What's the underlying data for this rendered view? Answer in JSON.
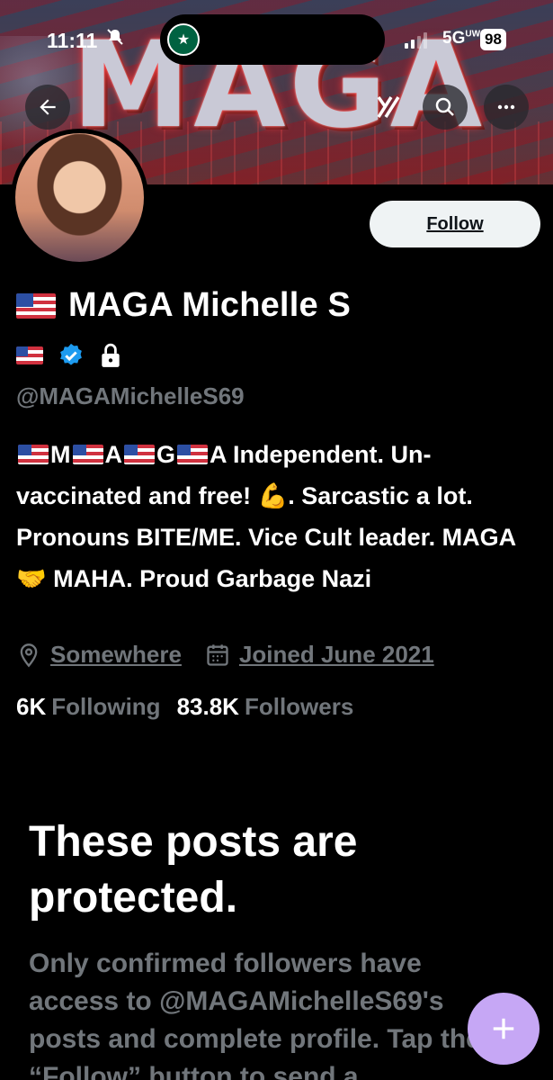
{
  "status_bar": {
    "time": "11:11",
    "network": "5G",
    "network_sup": "UW",
    "battery": "98",
    "icons": [
      "bell-off-icon",
      "starbucks-app-icon",
      "signal-icon"
    ]
  },
  "banner": {
    "text": "MAGA"
  },
  "top_actions": {
    "icons": [
      "back-arrow-icon",
      "grok-icon",
      "search-icon",
      "more-icon"
    ]
  },
  "profile": {
    "display_name": "MAGA Michelle S",
    "handle": "@MAGAMichelleS69",
    "badges": [
      "us-flag-icon",
      "verified-icon",
      "lock-icon"
    ],
    "follow_label": "Follow",
    "bio": {
      "part1": "M",
      "part2": "A",
      "part3": "G",
      "part4": "A Independent. Un-vaccinated and free! ",
      "part5": ". Sarcastic a lot. Pronouns BITE/ME. Vice Cult leader. MAGA",
      "part6": " MAHA. Proud Garbage Nazi",
      "emojis": [
        "flexed-biceps-emoji",
        "handshake-emoji"
      ]
    },
    "location": "Somewhere",
    "joined": "Joined June 2021",
    "following_count": "6K",
    "following_label": "Following",
    "followers_count": "83.8K",
    "followers_label": "Followers"
  },
  "protected": {
    "title": "These posts are protected.",
    "description": "Only confirmed followers have access to @MAGAMichelleS69's posts and complete profile. Tap the “Follow” button to send a"
  },
  "fab": {
    "icon": "plus-icon"
  },
  "colors": {
    "accent_fab": "#c6a7f5",
    "verified": "#1d9bf0",
    "muted": "#71767b"
  }
}
